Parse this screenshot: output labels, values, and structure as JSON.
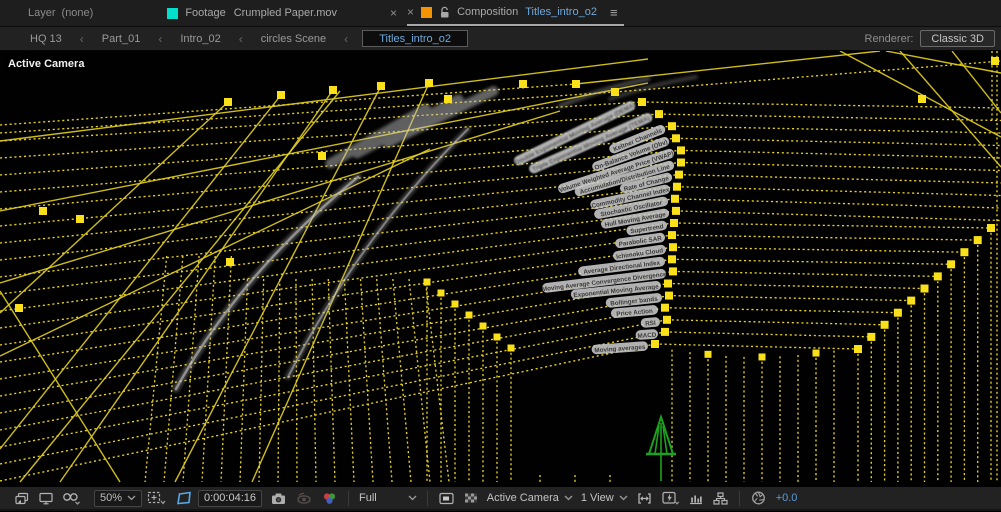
{
  "tabs": {
    "layer": {
      "title": "Layer",
      "value": "(none)"
    },
    "footage": {
      "title": "Footage",
      "file": "Crumpled Paper.mov",
      "close": "×",
      "swatch": "#00DFCB"
    },
    "composition": {
      "close": "×",
      "title": "Composition",
      "name": "Titles_intro_o2",
      "swatch": "#F59400",
      "menu": "≡"
    }
  },
  "breadcrumbs": {
    "separator": "‹",
    "items": [
      "HQ 13",
      "Part_01",
      "Intro_02",
      "circles Scene"
    ],
    "current": "Titles_intro_o2",
    "renderer_label": "Renderer:",
    "renderer_value": "Classic 3D"
  },
  "viewport": {
    "camera_label": "Active Camera",
    "indicator_labels": [
      "Double Exponential Moving Average (DEMA)",
      "Triple Exponential Moving Average (TEMA)",
      "Keltner Channels",
      "On-Balance Volume (Obv)",
      "Volume Weighted Average Price (VWAP)",
      "Accumulation/Distribution Line",
      "Rate of Change",
      "Commodity Channel Index",
      "Stochastic Oscillator",
      "Hull Moving Average",
      "Supertrend",
      "Parabolic SAR",
      "Ichimoku Cloud",
      "Average Directional Index",
      "Moving Average Convergence Divergence",
      "Exponential Moving Average",
      "Bollinger bands",
      "Price Action",
      "RSI",
      "MACD",
      "Moving averages"
    ],
    "colors": {
      "wireframe": "#E6D11E",
      "handles": "#F9E018",
      "label_pill": "#C9C9C9",
      "label_text": "#3A3A3A",
      "axis_green": "#1DA21D"
    }
  },
  "toolbar": {
    "zoom": "50%",
    "timecode": "0:00:04:16",
    "resolution": "Full",
    "camera_view": "Active Camera",
    "view_layout": "1 View",
    "exposure": "+0.0"
  }
}
